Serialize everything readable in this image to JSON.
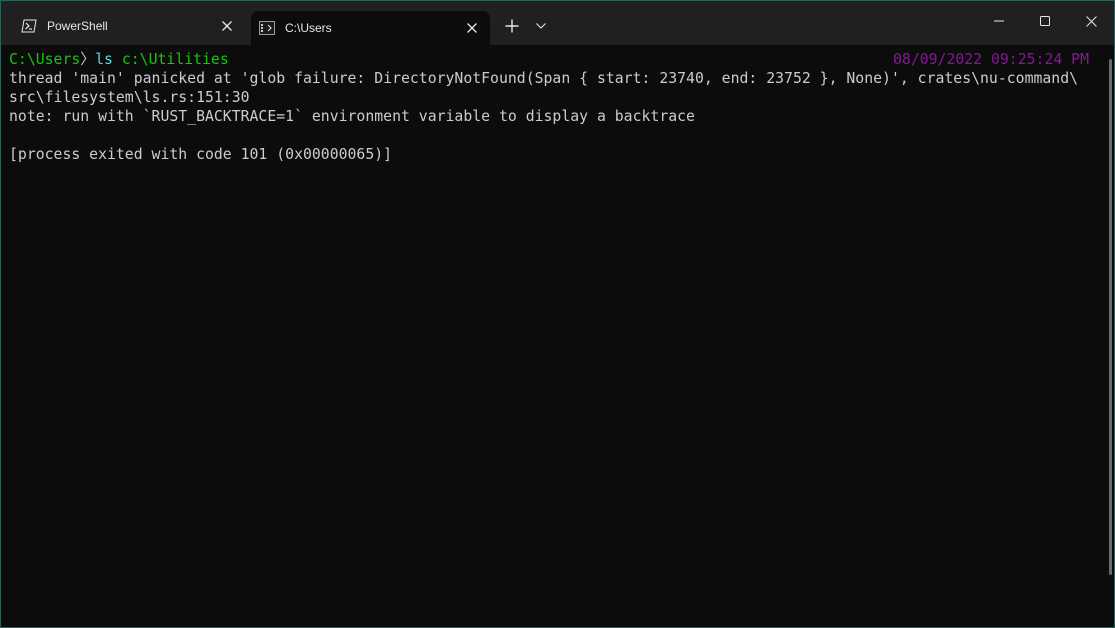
{
  "tabs": [
    {
      "label": "PowerShell",
      "icon": "powershell-icon",
      "active": false
    },
    {
      "label": "C:\\Users",
      "icon": "terminal-icon",
      "active": true
    }
  ],
  "terminal": {
    "prompt_path": "C:\\Users",
    "prompt_separator": "〉",
    "command": "ls",
    "command_arg": "c:\\Utilities",
    "timestamp": "08/09/2022 09:25:24 PM",
    "line2": "thread 'main' panicked at 'glob failure: DirectoryNotFound(Span { start: 23740, end: 23752 }, None)', crates\\nu-command\\",
    "line3": "src\\filesystem\\ls.rs:151:30",
    "line4": "note: run with `RUST_BACKTRACE=1` environment variable to display a backtrace",
    "line5": "[process exited with code 101 (0x00000065)]"
  },
  "colors": {
    "background": "#0c0c0c",
    "titlebar": "#202020",
    "prompt_green": "#16c60c",
    "command_cyan": "#61d6d6",
    "timestamp_purple": "#881798"
  }
}
